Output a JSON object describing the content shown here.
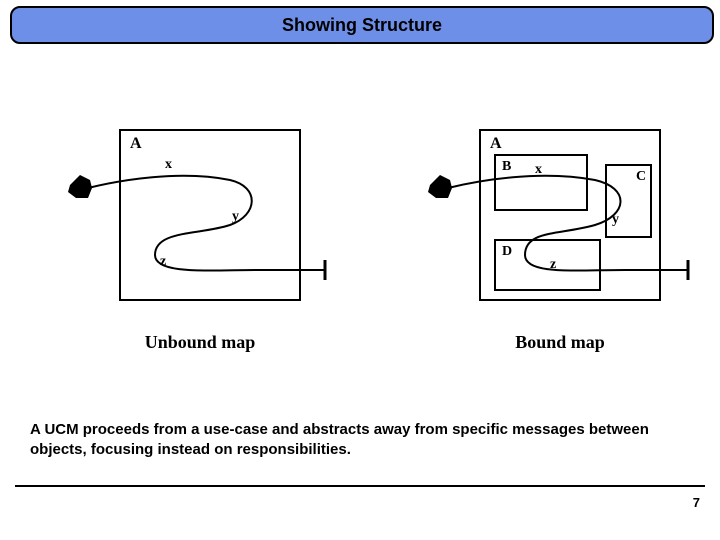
{
  "title": "Showing Structure",
  "diagrams": {
    "left": {
      "caption": "Unbound map",
      "box_label": "A",
      "path_points": {
        "x": "x",
        "y": "y",
        "z": "z"
      }
    },
    "right": {
      "caption": "Bound map",
      "box_label": "A",
      "inner_boxes": {
        "B": "B",
        "C": "C",
        "D": "D"
      },
      "path_points": {
        "x": "x",
        "y": "y",
        "z": "z"
      }
    }
  },
  "body_text": "A UCM proceeds from a use-case and abstracts away from specific messages between objects, focusing instead on responsibilities.",
  "page_number": "7"
}
